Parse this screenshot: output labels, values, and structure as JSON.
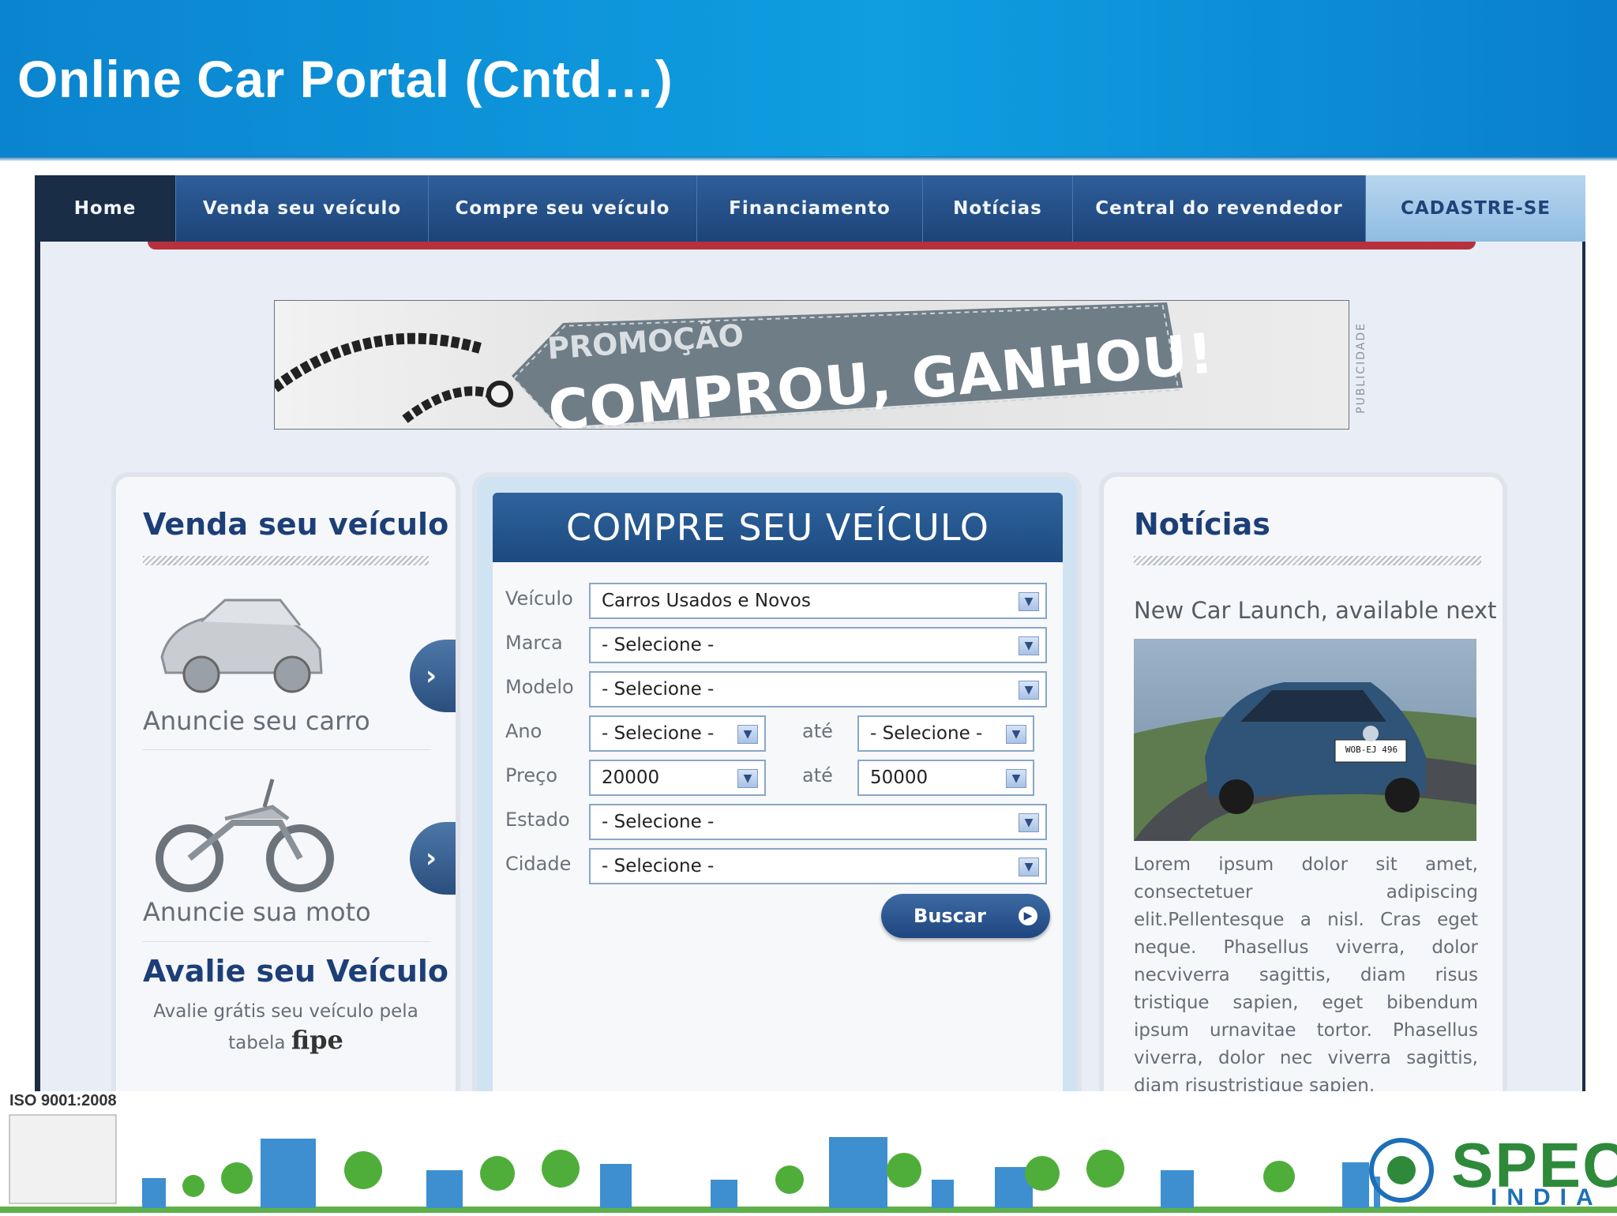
{
  "slide": {
    "title": "Online Car Portal (Cntd…)"
  },
  "nav": {
    "items": [
      {
        "label": "Home"
      },
      {
        "label": "Venda seu veículo"
      },
      {
        "label": "Compre seu veículo"
      },
      {
        "label": "Financiamento"
      },
      {
        "label": "Notícias"
      },
      {
        "label": "Central do revendedor"
      },
      {
        "label": "CADASTRE-SE"
      }
    ]
  },
  "banner": {
    "promo_small": "PROMOÇÃO",
    "promo_big": "COMPROU, GANHOU!",
    "side_label": "PUBLICIDADE"
  },
  "sell": {
    "title": "Venda seu veículo",
    "car_label": "Anuncie seu carro",
    "moto_label": "Anuncie sua moto",
    "evaluate_title": "Avalie seu Veículo",
    "evaluate_text": "Avalie grátis seu veículo pela",
    "evaluate_text2": "tabela",
    "fipe": "fipe"
  },
  "buy": {
    "title": "COMPRE SEU VEÍCULO",
    "fields": {
      "veiculo": {
        "label": "Veículo",
        "value": "Carros Usados e Novos"
      },
      "marca": {
        "label": "Marca",
        "value": "- Selecione -"
      },
      "modelo": {
        "label": "Modelo",
        "value": "- Selecione -"
      },
      "ano": {
        "label": "Ano",
        "from": "- Selecione -",
        "to": "- Selecione -"
      },
      "preco": {
        "label": "Preço",
        "from": "20000",
        "to": "50000"
      },
      "estado": {
        "label": "Estado",
        "value": "- Selecione -"
      },
      "cidade": {
        "label": "Cidade",
        "value": "- Selecione -"
      }
    },
    "ate": "até",
    "search_button": "Buscar"
  },
  "news": {
    "title": "Notícias",
    "headline": "New Car Launch, available next",
    "plate": "WOB-EJ 496",
    "body": "Lorem ipsum dolor sit amet, consectetuer adipiscing elit.Pellentesque a nisl. Cras eget neque. Phasellus viverra, dolor necviverra sagittis, diam risus tristique sapien, eget bibendum ipsum urnavitae tortor. Phasellus viverra, dolor nec viverra sagittis, diam risustristique sapien."
  },
  "footer": {
    "iso": "ISO 9001:2008",
    "logo_main": "SPEC",
    "logo_sub": "INDIA"
  },
  "colors": {
    "header_blue": "#0f9ee0",
    "nav_blue": "#1c4478",
    "accent_red": "#b7313d",
    "green": "#2e8a3a"
  }
}
